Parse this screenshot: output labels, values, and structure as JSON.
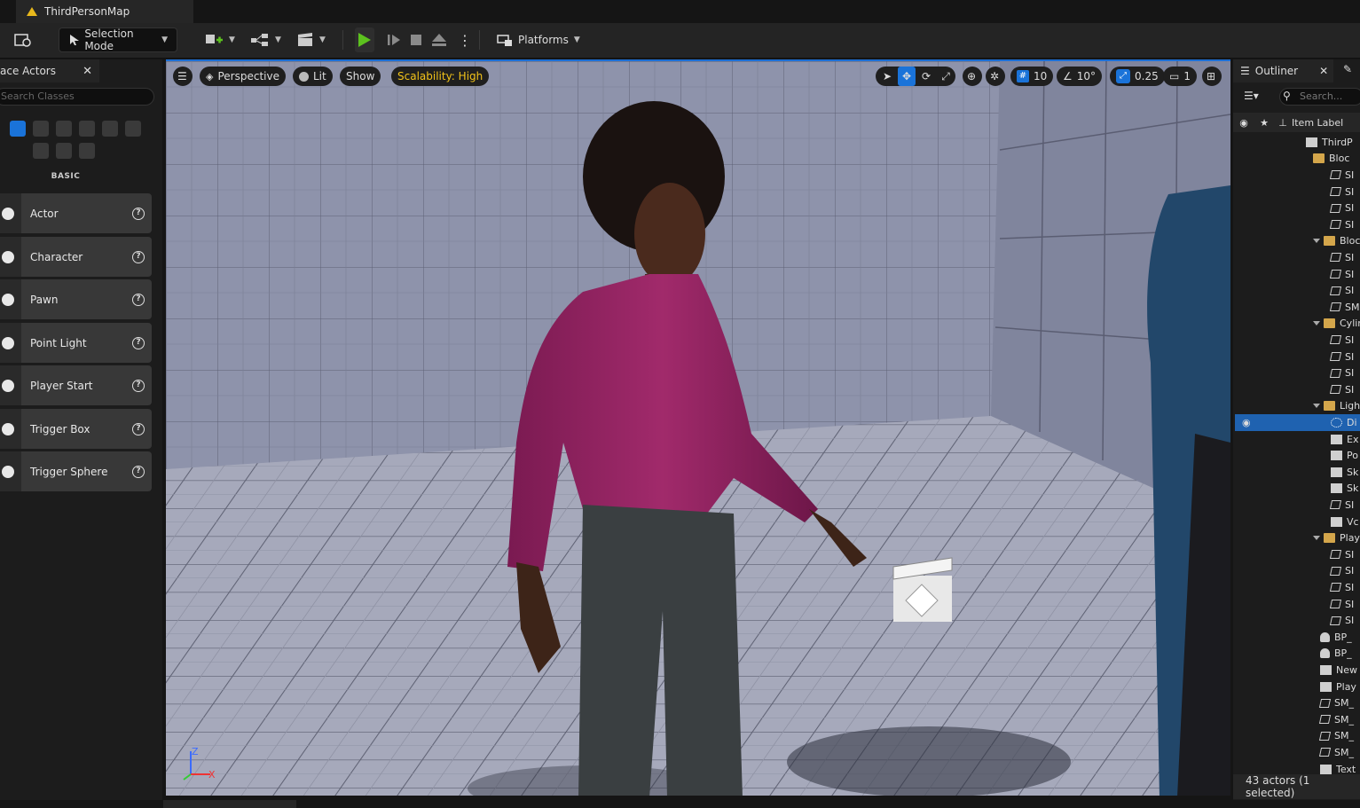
{
  "window": {
    "document_tab": "ThirdPersonMap"
  },
  "toolbar": {
    "selection_mode": "Selection Mode",
    "platforms": "Platforms"
  },
  "place_actors": {
    "tab_label": "ace Actors",
    "search_placeholder": "Search Classes",
    "section_label": "BASIC",
    "items": [
      {
        "label": "Actor"
      },
      {
        "label": "Character"
      },
      {
        "label": "Pawn"
      },
      {
        "label": "Point Light"
      },
      {
        "label": "Player Start"
      },
      {
        "label": "Trigger Box"
      },
      {
        "label": "Trigger Sphere"
      }
    ]
  },
  "viewport": {
    "perspective": "Perspective",
    "lit": "Lit",
    "show": "Show",
    "scalability": "Scalability: High",
    "grid_snap": "10",
    "rotation_snap": "10°",
    "scale_snap": "0.25",
    "camera_speed": "1",
    "axis_z": "Z",
    "axis_x": "X"
  },
  "outliner": {
    "tab_label": "Outliner",
    "search_placeholder": "Search...",
    "column_item_label": "Item Label",
    "rows": [
      {
        "label": "ThirdP",
        "icon": "level-icon"
      },
      {
        "label": "Bloc",
        "icon": "folder-icon"
      },
      {
        "label": "SI",
        "icon": "static-mesh-icon"
      },
      {
        "label": "SI",
        "icon": "static-mesh-icon"
      },
      {
        "label": "SI",
        "icon": "static-mesh-icon"
      },
      {
        "label": "SI",
        "icon": "static-mesh-icon"
      },
      {
        "label": "Bloc",
        "icon": "folder-icon"
      },
      {
        "label": "SI",
        "icon": "static-mesh-icon"
      },
      {
        "label": "SI",
        "icon": "static-mesh-icon"
      },
      {
        "label": "SI",
        "icon": "static-mesh-icon"
      },
      {
        "label": "SM",
        "icon": "static-mesh-icon"
      },
      {
        "label": "Cylir",
        "icon": "folder-icon"
      },
      {
        "label": "SI",
        "icon": "static-mesh-icon"
      },
      {
        "label": "SI",
        "icon": "static-mesh-icon"
      },
      {
        "label": "SI",
        "icon": "static-mesh-icon"
      },
      {
        "label": "SI",
        "icon": "static-mesh-icon"
      },
      {
        "label": "Ligh",
        "icon": "folder-icon"
      },
      {
        "label": "Di",
        "icon": "directional-light-icon"
      },
      {
        "label": "Ex",
        "icon": "fog-icon"
      },
      {
        "label": "Po",
        "icon": "post-process-icon"
      },
      {
        "label": "Sk",
        "icon": "sky-light-icon"
      },
      {
        "label": "Sk",
        "icon": "sky-atmosphere-icon"
      },
      {
        "label": "SI",
        "icon": "static-mesh-icon"
      },
      {
        "label": "Vc",
        "icon": "volumetric-cloud-icon"
      },
      {
        "label": "Play",
        "icon": "folder-icon"
      },
      {
        "label": "SI",
        "icon": "static-mesh-icon"
      },
      {
        "label": "SI",
        "icon": "static-mesh-icon"
      },
      {
        "label": "SI",
        "icon": "static-mesh-icon"
      },
      {
        "label": "SI",
        "icon": "static-mesh-icon"
      },
      {
        "label": "SI",
        "icon": "static-mesh-icon"
      },
      {
        "label": "BP_",
        "icon": "blueprint-pawn-icon"
      },
      {
        "label": "BP_",
        "icon": "blueprint-pawn-icon"
      },
      {
        "label": "New",
        "icon": "level-sequence-icon"
      },
      {
        "label": "Play",
        "icon": "player-start-icon"
      },
      {
        "label": "SM_",
        "icon": "static-mesh-icon"
      },
      {
        "label": "SM_",
        "icon": "static-mesh-icon"
      },
      {
        "label": "SM_",
        "icon": "static-mesh-icon"
      },
      {
        "label": "SM_",
        "icon": "static-mesh-icon"
      },
      {
        "label": "Text",
        "icon": "text-render-icon"
      }
    ],
    "status": "43 actors (1 selected)"
  },
  "colors": {
    "accent": "#1c6fd6",
    "play": "#5cc11e",
    "scalability": "#f2c319",
    "shirt": "#9c2466"
  }
}
